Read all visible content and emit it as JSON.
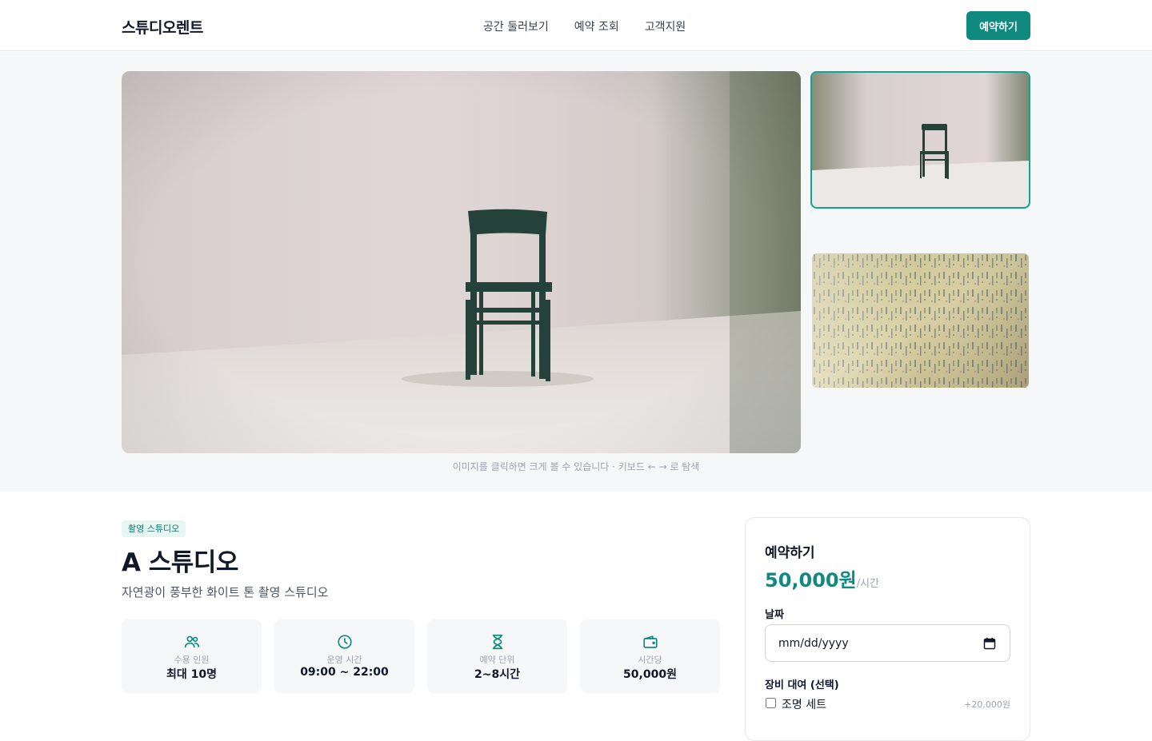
{
  "header": {
    "brand": "스튜디오렌트",
    "nav": [
      "공간 둘러보기",
      "예약 조회",
      "고객지원"
    ],
    "cta": "예약하기"
  },
  "gallery": {
    "hint": "이미지를 클릭하면 크게 볼 수 있습니다 · 키보드 ← → 로 탐색",
    "accent_color": "#14a291"
  },
  "studio": {
    "category": "촬영 스튜디오",
    "name": "A 스튜디오",
    "tagline": "자연광이 풍부한 화이트 톤 촬영 스튜디오",
    "info": [
      {
        "icon": "people-icon",
        "label": "수용 인원",
        "value": "최대 10명"
      },
      {
        "icon": "clock-icon",
        "label": "운영 시간",
        "value": "09:00 ~ 22:00"
      },
      {
        "icon": "hourglass-icon",
        "label": "예약 단위",
        "value": "2~8시간"
      },
      {
        "icon": "wallet-icon",
        "label": "시간당",
        "value": "50,000원"
      }
    ]
  },
  "booking": {
    "heading": "예약하기",
    "price": "50,000원",
    "unit": "/시간",
    "date_label": "날짜",
    "date_placeholder": "mm/dd/yyyy",
    "equipment_label": "장비 대여 (선택)",
    "equipment": [
      {
        "name": "조명 세트",
        "extra": "+20,000원"
      }
    ]
  },
  "colors": {
    "primary": "#0f8a7e",
    "text": "#111827",
    "muted": "#9ca3af"
  }
}
